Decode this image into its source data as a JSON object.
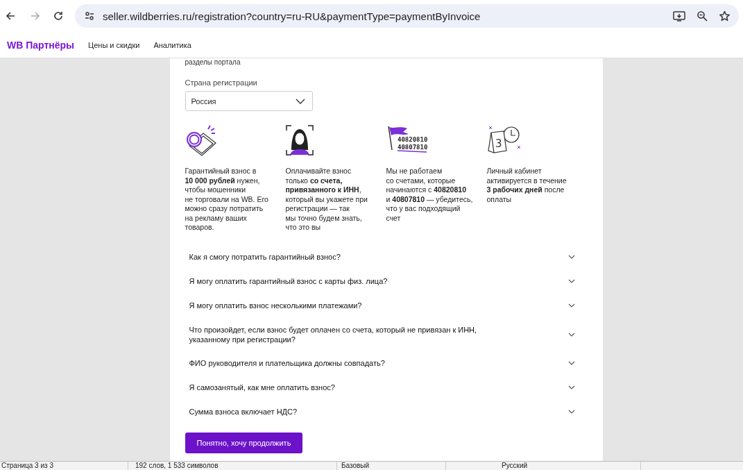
{
  "browser": {
    "nav_buttons": [
      {
        "kind": "back",
        "disabled": false
      },
      {
        "kind": "forward",
        "disabled": true
      },
      {
        "kind": "reload",
        "disabled": false
      }
    ],
    "url": "seller.wildberries.ru/registration?country=ru-RU&paymentType=paymentByInvoice"
  },
  "header": {
    "logo": "WB Партнёры",
    "links": [
      "Цены и скидки",
      "Аналитика"
    ]
  },
  "card": {
    "top_text": "разделы портала",
    "country_label": "Страна регистрации",
    "country_value": "Россия",
    "features": [
      {
        "kind": "coin",
        "text": "Гарантийный взнос в\n**10 000 рублей** нужен,\nчтобы мошенники\nне торговали на WB. Его\nможно сразу потратить\nна рекламу ваших\nтоваров."
      },
      {
        "kind": "person",
        "text": "Оплачивайте взнос\nтолько **со счета,\nпривязанного к ИНН**,\nкоторый вы укажете при\nрегистрации — так\nмы точно будем знать,\nчто это вы"
      },
      {
        "kind": "flag",
        "numbers": [
          "40820810",
          "40807810"
        ],
        "text": "Мы не работаем\nсо счетами, которые\nначинаются с **40820810**\nи **40807810** — убедитесь,\nчто у вас подходящий\nсчет"
      },
      {
        "kind": "calendar",
        "day": "3",
        "text": "Личный кабинет\nактивируется в течение\n**3 рабочих дней** после\nоплаты"
      }
    ],
    "faq": [
      {
        "question": "Как я смогу потратить гарантийный взнос?",
        "expanded": false
      },
      {
        "question": "Я могу оплатить гарантийный взнос с карты физ. лица?",
        "expanded": false
      },
      {
        "question": "Я могу оплатить взнос несколькими платежами?",
        "expanded": false
      },
      {
        "question": "Что произойдет, если взнос будет оплачен со счета, который не привязан к ИНН,\nуказанному при регистрации?",
        "expanded": false
      },
      {
        "question": "ФИО руководителя и плательщика должны совпадать?",
        "expanded": false
      },
      {
        "question": "Я самозанятый, как мне оплатить взнос?",
        "expanded": false
      },
      {
        "question": "Сумма взноса включает НДС?",
        "expanded": false
      }
    ],
    "button": "Понятно, хочу продолжить"
  },
  "status_bar": {
    "page": "Страница 3 из 3",
    "words": "192 слов, 1 533 символов",
    "style": "Базовый",
    "language": "Русский"
  }
}
